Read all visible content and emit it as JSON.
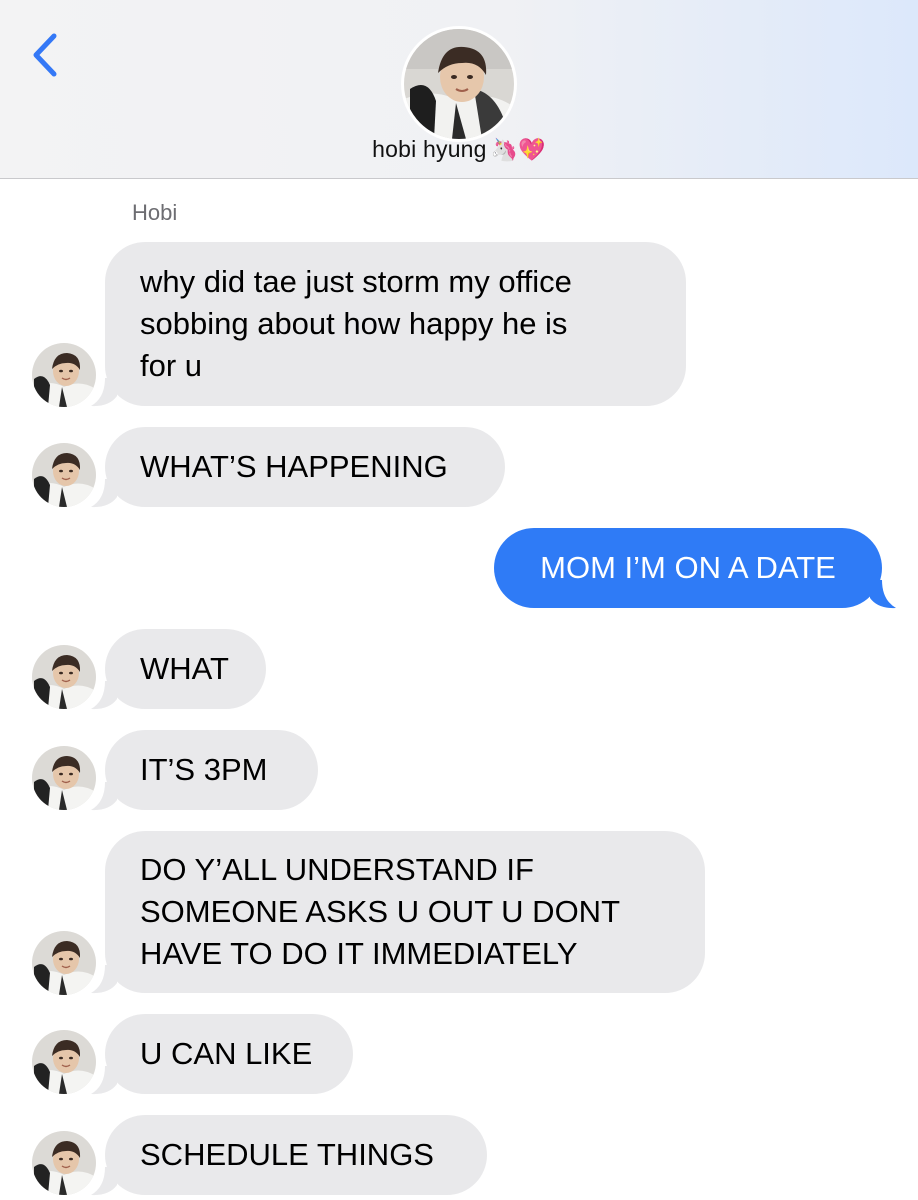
{
  "header": {
    "contact_name": "hobi hyung",
    "contact_emoji": "🦄💖",
    "back_icon": "chevron-left-icon"
  },
  "thread": {
    "sender_label": "Hobi",
    "messages": [
      {
        "side": "in",
        "lines": [
          "why did tae just storm my office",
          "sobbing about how happy he is",
          "for u"
        ]
      },
      {
        "side": "in",
        "lines": [
          "WHAT’S HAPPENING"
        ]
      },
      {
        "side": "out",
        "lines": [
          "MOM I’M ON A DATE"
        ]
      },
      {
        "side": "in",
        "lines": [
          "WHAT"
        ]
      },
      {
        "side": "in",
        "lines": [
          "IT’S 3PM"
        ]
      },
      {
        "side": "in",
        "lines": [
          "DO Y’ALL UNDERSTAND IF",
          "SOMEONE ASKS U OUT U DONT",
          "HAVE TO DO IT IMMEDIATELY"
        ]
      },
      {
        "side": "in",
        "lines": [
          "U CAN LIKE"
        ]
      },
      {
        "side": "in",
        "lines": [
          "SCHEDULE THINGS"
        ]
      }
    ]
  },
  "colors": {
    "incoming_bubble": "#e9e9eb",
    "outgoing_bubble": "#2f7bf6",
    "accent": "#3478f6"
  }
}
